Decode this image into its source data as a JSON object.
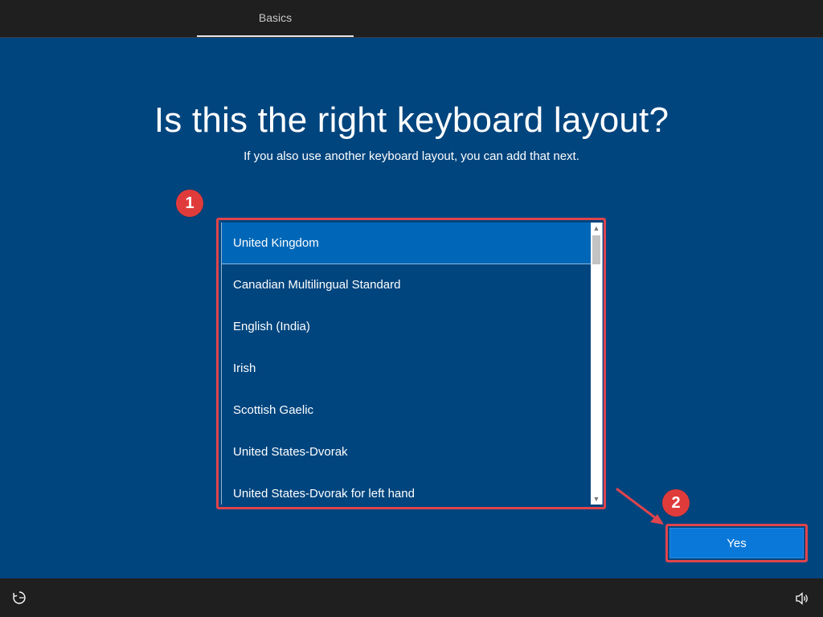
{
  "header": {
    "tab_label": "Basics"
  },
  "main": {
    "title": "Is this the right keyboard layout?",
    "subtitle": "If you also use another keyboard layout, you can add that next."
  },
  "keyboard_list": {
    "items": [
      {
        "label": "United Kingdom",
        "selected": true
      },
      {
        "label": "Canadian Multilingual Standard"
      },
      {
        "label": "English (India)"
      },
      {
        "label": "Irish"
      },
      {
        "label": "Scottish Gaelic"
      },
      {
        "label": "United States-Dvorak"
      },
      {
        "label": "United States-Dvorak for left hand"
      }
    ]
  },
  "annotations": {
    "step1": "1",
    "step2": "2",
    "highlight_color": "#e0444c"
  },
  "buttons": {
    "yes_label": "Yes"
  },
  "footer": {
    "left_icon": "ease-of-access-icon",
    "right_icon": "volume-icon"
  },
  "colors": {
    "background": "#00457e",
    "selected_item": "#0067b8",
    "accent_button": "#0a78d8",
    "bar": "#1f1f1f"
  }
}
